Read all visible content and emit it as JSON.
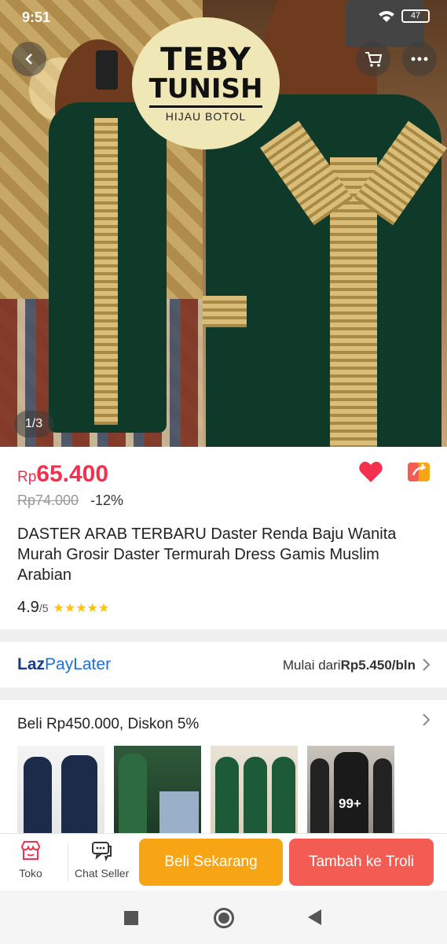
{
  "status": {
    "time": "9:51",
    "battery": "47"
  },
  "hero": {
    "logo_line1": "TEBY",
    "logo_line2": "TUNISH",
    "logo_line3": "HIJAU BOTOL",
    "page_indicator": "1/3"
  },
  "product": {
    "currency": "Rp",
    "price": "65.400",
    "old_price": "Rp74.000",
    "discount": "-12%",
    "title": "DASTER ARAB TERBARU Daster Renda Baju Wanita Murah Grosir Daster Termurah Dress Gamis Muslim Arabian",
    "rating": "4.9",
    "rating_max": "/5",
    "stars": "★★★★★"
  },
  "lazpay": {
    "brand_a": "Laz",
    "brand_b": "PayLater",
    "prefix": "Mulai dari",
    "amount": "Rp5.450/bln"
  },
  "promo": {
    "title": "Beli Rp450.000, Diskon 5%",
    "more_badge": "99+"
  },
  "actionbar": {
    "store_label": "Toko",
    "chat_label": "Chat Seller",
    "buy_label": "Beli Sekarang",
    "cart_label": "Tambah ke Troli"
  },
  "colors": {
    "price_red": "#f5304f",
    "buy_orange": "#f7a515",
    "cart_red": "#f25c53",
    "star_yellow": "#ffc300"
  }
}
